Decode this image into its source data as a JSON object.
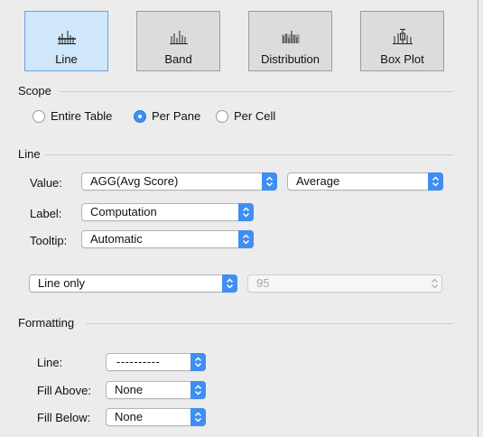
{
  "types": [
    {
      "label": "Line",
      "selected": true
    },
    {
      "label": "Band",
      "selected": false
    },
    {
      "label": "Distribution",
      "selected": false
    },
    {
      "label": "Box Plot",
      "selected": false
    }
  ],
  "scope": {
    "title": "Scope",
    "options": [
      {
        "label": "Entire Table",
        "checked": false
      },
      {
        "label": "Per Pane",
        "checked": true
      },
      {
        "label": "Per Cell",
        "checked": false
      }
    ]
  },
  "line": {
    "title": "Line",
    "value_label": "Value:",
    "value_select": "AGG(Avg Score)",
    "aggregation_select": "Average",
    "label_label": "Label:",
    "label_select": "Computation",
    "tooltip_label": "Tooltip:",
    "tooltip_select": "Automatic",
    "confidence_select": "Line only",
    "confidence_value": "95"
  },
  "formatting": {
    "title": "Formatting",
    "line_label": "Line:",
    "line_style": "----------",
    "fill_above_label": "Fill Above:",
    "fill_above_value": "None",
    "fill_below_label": "Fill Below:",
    "fill_below_value": "None"
  },
  "colors": {
    "accent": "#3f8ef2",
    "selected_tile": "#cfe6fb"
  }
}
